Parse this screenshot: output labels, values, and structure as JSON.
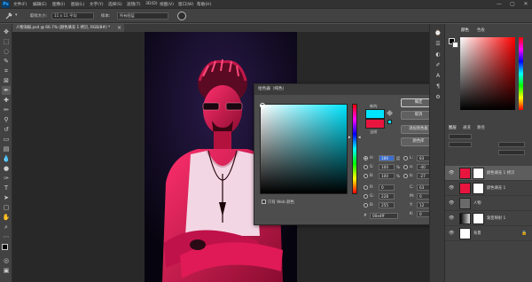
{
  "menubar": {
    "logo": "Ps",
    "items": [
      "文件(F)",
      "编辑(E)",
      "图像(I)",
      "图层(L)",
      "文字(Y)",
      "选择(S)",
      "滤镜(T)",
      "3D(D)",
      "视图(V)",
      "窗口(W)",
      "帮助(H)"
    ],
    "win_controls": [
      "—",
      "▢",
      "✕"
    ]
  },
  "options": {
    "sample_size_label": "取样大小:",
    "sample_size_value": "11 x 11 平均",
    "sample_label": "样本:",
    "sample_value": "所有图层"
  },
  "document": {
    "tab_title": "人物海报.psd @ 66.7% (颜色填充 1 拷贝, RGB/8#) *",
    "close_glyph": "×"
  },
  "dialog": {
    "title": "拾色器（纯色）",
    "close_glyph": "×",
    "new_label": "新的",
    "current_label": "当前",
    "new_color": "#00e5ff",
    "current_color": "#e8153f",
    "buttons": [
      "确定",
      "取消",
      "添加到色板",
      "颜色库"
    ],
    "fields_left": [
      {
        "label": "H:",
        "value": "186",
        "unit": "度",
        "selected": true
      },
      {
        "label": "S:",
        "value": "100",
        "unit": "%"
      },
      {
        "label": "B:",
        "value": "100",
        "unit": "%"
      },
      {
        "label": "R:",
        "value": "0",
        "unit": ""
      },
      {
        "label": "G:",
        "value": "228",
        "unit": ""
      },
      {
        "label": "B:",
        "value": "255",
        "unit": ""
      }
    ],
    "fields_right": [
      {
        "label": "L:",
        "value": "83",
        "unit": ""
      },
      {
        "label": "a:",
        "value": "-40",
        "unit": ""
      },
      {
        "label": "b:",
        "value": "-27",
        "unit": ""
      },
      {
        "label": "C:",
        "value": "63",
        "unit": "%"
      },
      {
        "label": "M:",
        "value": "0",
        "unit": "%"
      },
      {
        "label": "Y:",
        "value": "12",
        "unit": "%"
      },
      {
        "label": "K:",
        "value": "0",
        "unit": "%"
      }
    ],
    "web_only_label": "只有 Web 颜色",
    "hex_label": "#",
    "hex_value": "00e4ff"
  },
  "panels": {
    "color_tabs": [
      "颜色",
      "色板"
    ],
    "layer_tabs": [
      "图层",
      "通道",
      "路径"
    ],
    "layers": [
      {
        "name": "颜色填充 1 拷贝",
        "thumb": "#e8153f",
        "selected": true
      },
      {
        "name": "颜色填充 1",
        "thumb": "#e8153f",
        "selected": false
      },
      {
        "name": "人物",
        "thumb": "#6a6a6a",
        "selected": false
      },
      {
        "name": "渐变映射 1",
        "thumb": "#555555",
        "selected": false
      },
      {
        "name": "背景",
        "thumb": "#ffffff",
        "selected": false
      }
    ]
  }
}
